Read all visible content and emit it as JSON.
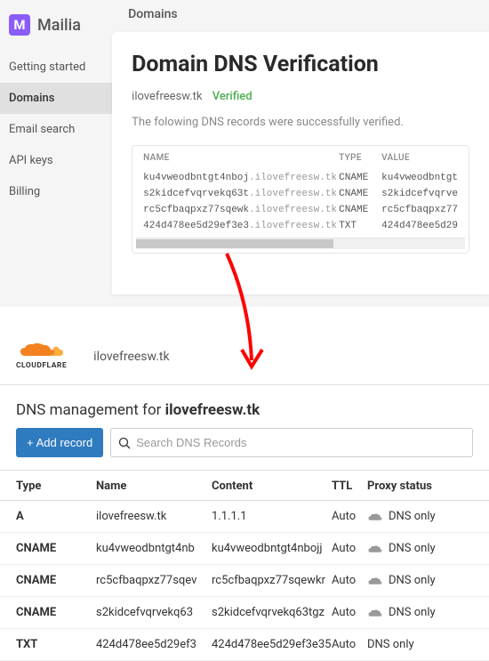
{
  "mailia": {
    "logo_text": "Mailia",
    "header": "Domains",
    "sidebar": [
      {
        "label": "Getting started",
        "active": false
      },
      {
        "label": "Domains",
        "active": true
      },
      {
        "label": "Email search",
        "active": false
      },
      {
        "label": "API keys",
        "active": false
      },
      {
        "label": "Billing",
        "active": false
      }
    ],
    "card": {
      "title": "Domain DNS Verification",
      "domain": "ilovefreesw.tk",
      "status": "Verified",
      "message": "The folowing DNS records were successfully verified.",
      "columns": {
        "name": "NAME",
        "type": "TYPE",
        "value": "VALUE"
      },
      "records": [
        {
          "sub": "ku4vweodbntgt4nboj",
          "dom": ".ilovefreesw.tk",
          "type": "CNAME",
          "value": "ku4vweodbntgt"
        },
        {
          "sub": "s2kidcefvqrvekq63t",
          "dom": ".ilovefreesw.tk",
          "type": "CNAME",
          "value": "s2kidcefvqrve"
        },
        {
          "sub": "rc5cfbaqpxz77sqewk",
          "dom": ".ilovefreesw.tk",
          "type": "CNAME",
          "value": "rc5cfbaqpxz77"
        },
        {
          "sub": "424d478ee5d29ef3e3",
          "dom": ".ilovefreesw.tk",
          "type": "TXT",
          "value": "424d478ee5d29"
        }
      ]
    }
  },
  "cloudflare": {
    "logo_text": "CLOUDFLARE",
    "domain": "ilovefreesw.tk",
    "title_prefix": "DNS management for ",
    "title_domain": "ilovefreesw.tk",
    "add_button": "Add record",
    "search_placeholder": "Search DNS Records",
    "columns": {
      "type": "Type",
      "name": "Name",
      "content": "Content",
      "ttl": "TTL",
      "proxy": "Proxy status"
    },
    "records": [
      {
        "type": "A",
        "name": "ilovefreesw.tk",
        "content": "1.1.1.1",
        "ttl": "Auto",
        "proxy": "DNS only",
        "cloud": true
      },
      {
        "type": "CNAME",
        "name": "ku4vweodbntgt4nb",
        "content": "ku4vweodbntgt4nbojj",
        "ttl": "Auto",
        "proxy": "DNS only",
        "cloud": true
      },
      {
        "type": "CNAME",
        "name": "rc5cfbaqpxz77sqev",
        "content": "rc5cfbaqpxz77sqewkr",
        "ttl": "Auto",
        "proxy": "DNS only",
        "cloud": true
      },
      {
        "type": "CNAME",
        "name": "s2kidcefvqrvekq63",
        "content": "s2kidcefvqrvekq63tgz",
        "ttl": "Auto",
        "proxy": "DNS only",
        "cloud": true
      },
      {
        "type": "TXT",
        "name": "424d478ee5d29ef3",
        "content": "424d478ee5d29ef3e35",
        "ttl": "Auto",
        "proxy": "DNS only",
        "cloud": false
      }
    ]
  }
}
